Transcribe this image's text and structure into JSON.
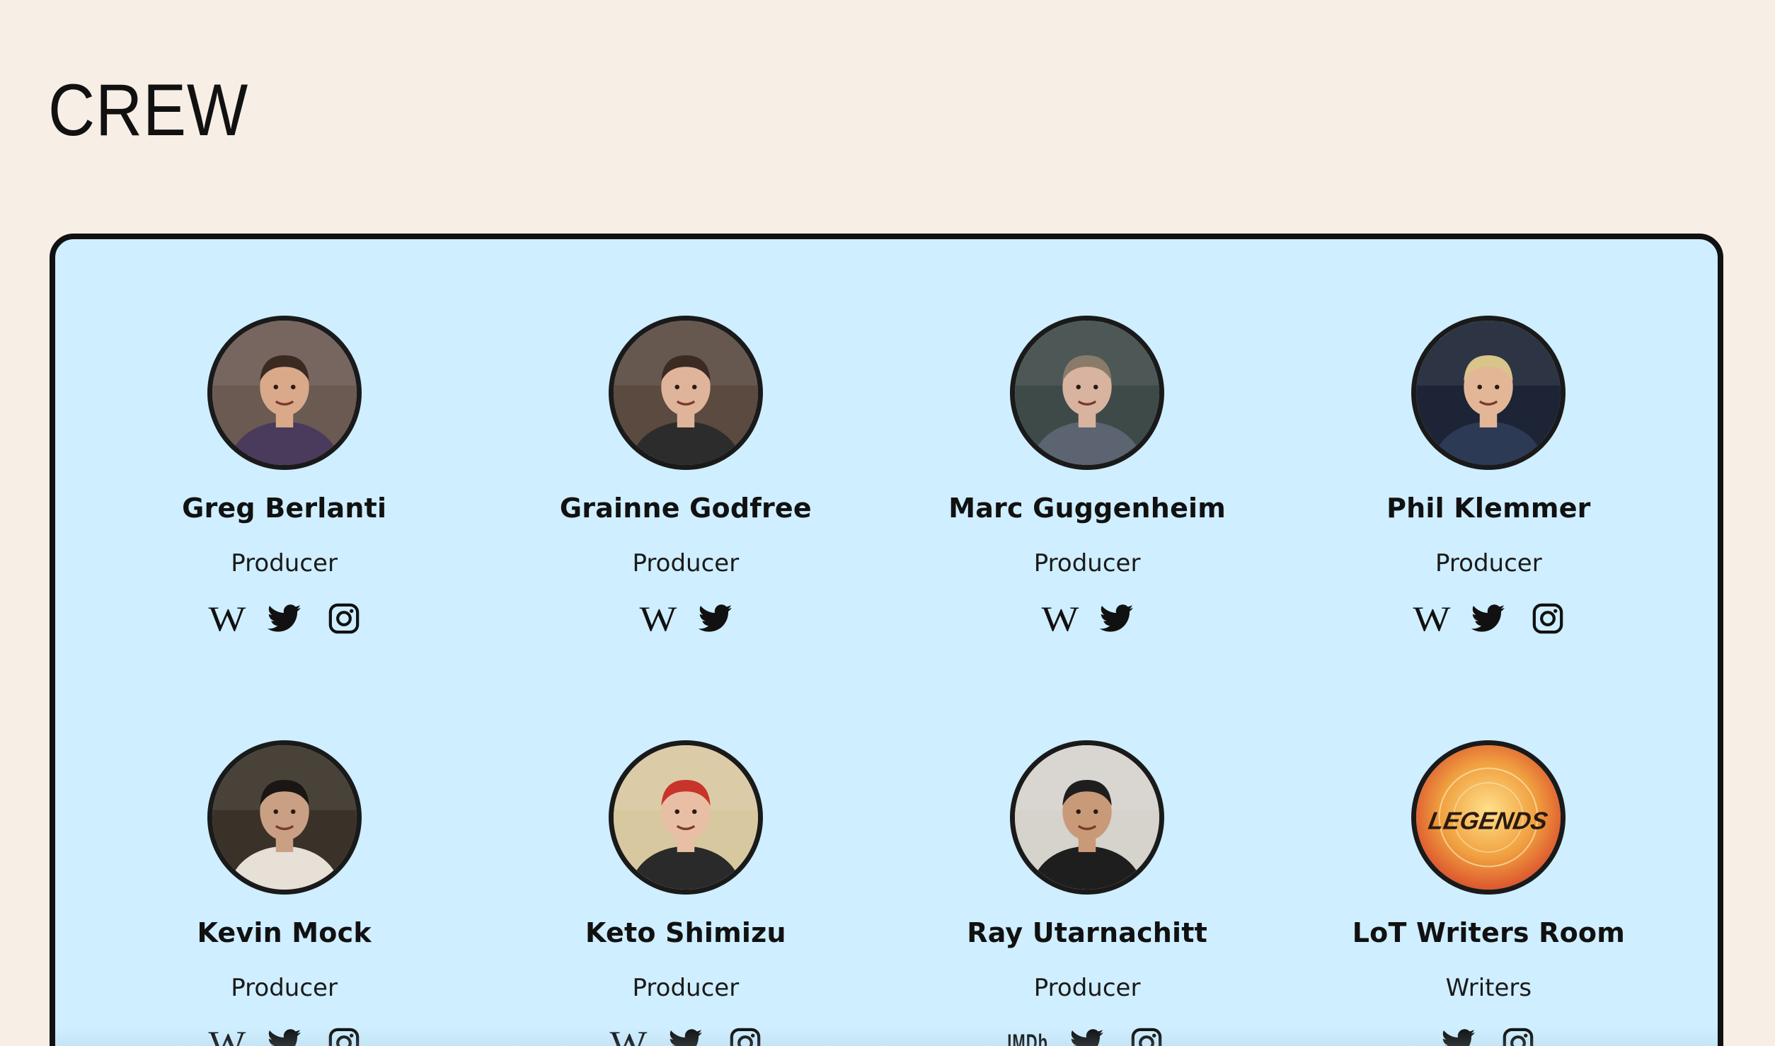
{
  "section_title": "CREW",
  "crew": [
    {
      "name": "Greg Berlanti",
      "role": "Producer",
      "avatar": {
        "bg": "#6b5a52",
        "skin": "#d9a98a",
        "hair": "#3a2a22",
        "shirt": "#4a3a5c"
      },
      "links": [
        "wikipedia-icon",
        "twitter-icon",
        "instagram-icon"
      ]
    },
    {
      "name": "Grainne Godfree",
      "role": "Producer",
      "avatar": {
        "bg": "#5a4a40",
        "skin": "#e0b49a",
        "hair": "#3b2b22",
        "shirt": "#2c2c2c"
      },
      "links": [
        "wikipedia-icon",
        "twitter-icon"
      ]
    },
    {
      "name": "Marc Guggenheim",
      "role": "Producer",
      "avatar": {
        "bg": "#3e4a48",
        "skin": "#d8b4a0",
        "hair": "#8a7a6a",
        "shirt": "#5b6470"
      },
      "links": [
        "wikipedia-icon",
        "twitter-icon"
      ]
    },
    {
      "name": "Phil Klemmer",
      "role": "Producer",
      "avatar": {
        "bg": "#1c2436",
        "skin": "#e2b696",
        "hair": "#d9c48a",
        "shirt": "#2d3a55"
      },
      "links": [
        "wikipedia-icon",
        "twitter-icon",
        "instagram-icon"
      ]
    },
    {
      "name": "Kevin Mock",
      "role": "Producer",
      "avatar": {
        "bg": "#3a3228",
        "skin": "#c9a084",
        "hair": "#1a1614",
        "shirt": "#e6e0d6"
      },
      "links": [
        "wikipedia-icon",
        "twitter-icon",
        "instagram-icon"
      ]
    },
    {
      "name": "Keto Shimizu",
      "role": "Producer",
      "avatar": {
        "bg": "#d8c8a0",
        "skin": "#e8bfa4",
        "hair": "#c8342a",
        "shirt": "#2a2a2a"
      },
      "links": [
        "wikipedia-icon",
        "twitter-icon",
        "instagram-icon"
      ]
    },
    {
      "name": "Ray Utarnachitt",
      "role": "Producer",
      "avatar": {
        "bg": "#d6d2cc",
        "skin": "#c99a78",
        "hair": "#1e1e1e",
        "shirt": "#1e1e1e"
      },
      "links": [
        "imdb-icon",
        "twitter-icon",
        "instagram-icon"
      ]
    },
    {
      "name": "LoT Writers Room",
      "role": "Writers",
      "avatar": {
        "bg": "#f0a040",
        "skin": "#e85a2a",
        "hair": "#2a1a10",
        "shirt": "#f5c050",
        "logo_text": "LEGENDS"
      },
      "links": [
        "twitter-icon",
        "instagram-icon"
      ]
    }
  ],
  "icons": {
    "wikipedia": "W",
    "imdb": "IMDb"
  }
}
